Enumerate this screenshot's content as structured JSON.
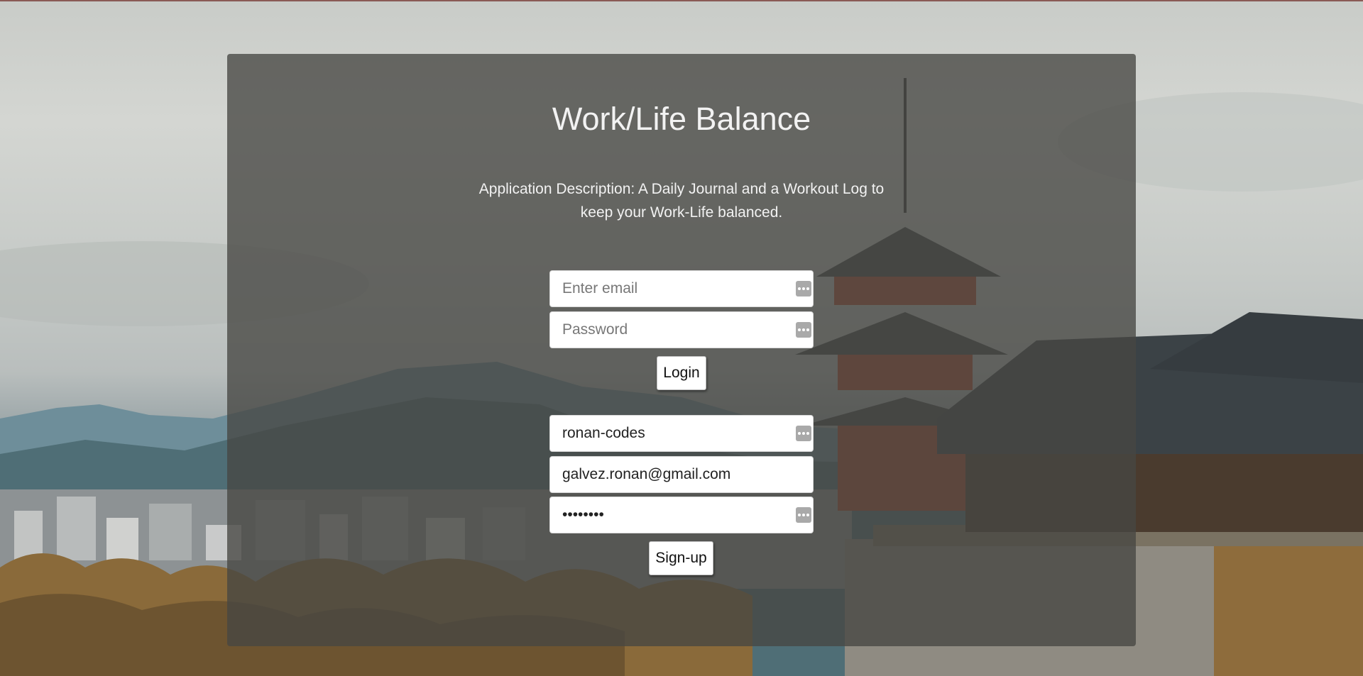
{
  "app": {
    "title": "Work/Life Balance",
    "description": "Application Description: A Daily Journal and a Workout Log to keep your Work-Life balanced."
  },
  "login": {
    "email_placeholder": "Enter email",
    "email_value": "",
    "password_placeholder": "Password",
    "password_value": "",
    "button_label": "Login"
  },
  "signup": {
    "username_value": "ronan-codes",
    "email_value": "galvez.ronan@gmail.com",
    "password_masked": "••••••••",
    "button_label": "Sign-up"
  },
  "icons": {
    "password_manager": "password-manager-icon"
  },
  "colors": {
    "card_overlay": "#464642",
    "title_text": "#f2f2f2",
    "field_bg": "#ffffff"
  }
}
